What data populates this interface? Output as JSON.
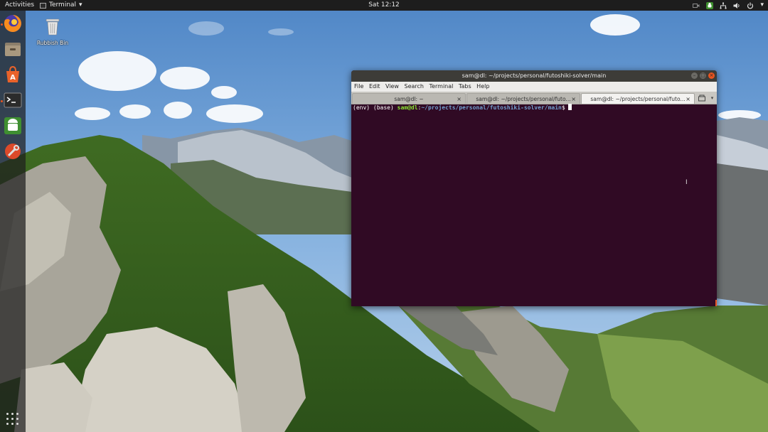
{
  "topbar": {
    "activities": "Activities",
    "app_name": "Terminal",
    "app_chevron": "▾",
    "clock": "Sat 12:12",
    "tray_icons": [
      "camera-icon",
      "android-icon",
      "network-icon",
      "volume-icon",
      "power-icon"
    ],
    "tray_chevron": "▾"
  },
  "dock": {
    "items": [
      {
        "name": "firefox",
        "icon": "firefox-icon",
        "running": true
      },
      {
        "name": "files",
        "icon": "files-icon",
        "running": false
      },
      {
        "name": "software",
        "icon": "software-center-icon",
        "running": false
      },
      {
        "name": "terminal",
        "icon": "terminal-icon",
        "running": true
      },
      {
        "name": "android",
        "icon": "android-icon",
        "running": false
      },
      {
        "name": "settings",
        "icon": "settings-tools-icon",
        "running": false
      }
    ],
    "show_apps_icon": "grid-icon"
  },
  "desktop": {
    "trash_label": "Rubbish Bin"
  },
  "terminal": {
    "title": "sam@dl: ~/projects/personal/futoshiki-solver/main",
    "menu": [
      "File",
      "Edit",
      "View",
      "Search",
      "Terminal",
      "Tabs",
      "Help"
    ],
    "tabs": [
      {
        "label": "sam@dl: ~",
        "active": false
      },
      {
        "label": "sam@dl: ~/projects/personal/futo...",
        "active": false
      },
      {
        "label": "sam@dl: ~/projects/personal/futo...",
        "active": true
      }
    ],
    "tab_close": "×",
    "prompt": {
      "prefix": "(env) (base) ",
      "user": "sam@dl",
      "colon": ":",
      "path": "~/projects/personal/futoshiki-solver/main",
      "symbol": "$ "
    },
    "colors": {
      "background": "#300a24",
      "user": "#8ae234",
      "path": "#729fcf",
      "accent": "#e95420"
    }
  }
}
